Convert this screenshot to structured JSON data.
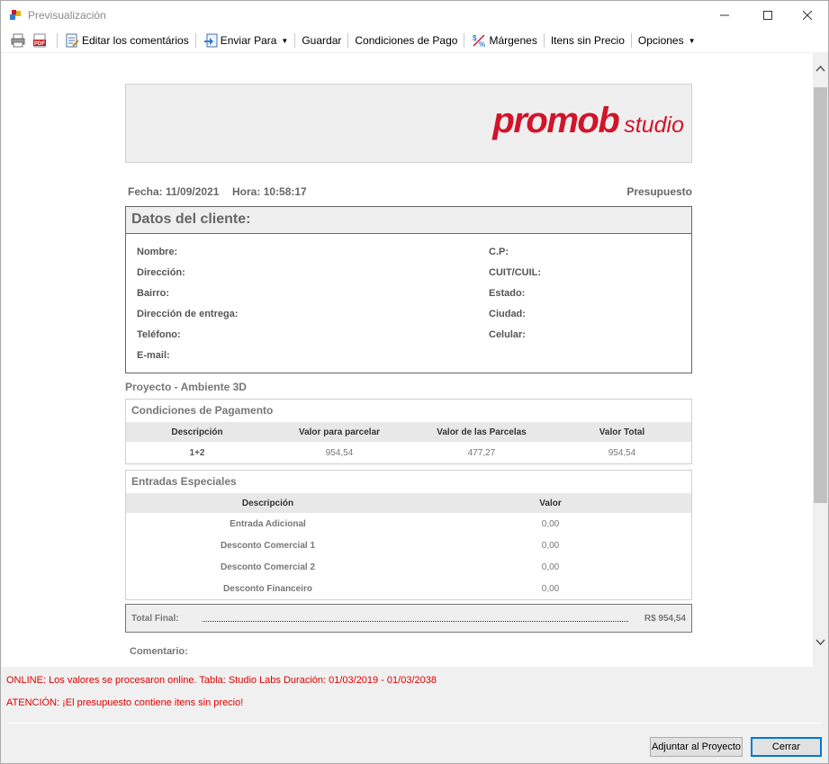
{
  "window": {
    "title": "Previsualización"
  },
  "toolbar": {
    "items": [
      {
        "icon": "print-icon"
      },
      {
        "icon": "pdf-icon",
        "label": "PDF"
      },
      {
        "icon": "edit-comments-icon",
        "label": "Editar los comentários"
      },
      {
        "icon": "send-icon",
        "label": "Enviar Para"
      },
      {
        "label": "Guardar"
      },
      {
        "label": "Condiciones de Pago"
      },
      {
        "icon": "margins-icon",
        "label": "Márgenes"
      },
      {
        "label": "Itens sin Precio"
      },
      {
        "label": "Opciones"
      }
    ]
  },
  "report": {
    "logo": {
      "main": "promob",
      "sub": "studio"
    },
    "fecha_label": "Fecha:",
    "fecha": "11/09/2021",
    "hora_label": "Hora:",
    "hora": "10:58:17",
    "doc_type": "Presupuesto",
    "client": {
      "title": "Datos del cliente:",
      "left_fields": [
        "Nombre:",
        "Dirección:",
        "Bairro:",
        "Dirección de entrega:",
        "Teléfono:",
        "E-mail:"
      ],
      "right_fields": [
        "C.P:",
        "CUIT/CUIL:",
        "Estado:",
        "Ciudad:",
        "Celular:"
      ]
    },
    "project_title": "Proyecto - Ambiente 3D",
    "payment": {
      "title": "Condiciones de Pagamento",
      "headers": [
        "Descripción",
        "Valor para parcelar",
        "Valor de las Parcelas",
        "Valor Total"
      ],
      "rows": [
        [
          "1+2",
          "954,54",
          "477,27",
          "954,54"
        ]
      ]
    },
    "special": {
      "title": "Entradas Especiales",
      "headers": [
        "Descripción",
        "Valor"
      ],
      "rows": [
        [
          "Entrada Adicional",
          "0,00"
        ],
        [
          "Desconto Comercial 1",
          "0,00"
        ],
        [
          "Desconto Comercial 2",
          "0,00"
        ],
        [
          "Desconto Financeiro",
          "0,00"
        ]
      ]
    },
    "total": {
      "label": "Total Final:",
      "value": "R$ 954,54"
    },
    "comment_label": "Comentario:"
  },
  "status": {
    "online": "ONLINE: Los valores se procesaron online. Tabla: Studio Labs Duración: 01/03/2019 - 01/03/2038",
    "warning": "ATENCIÓN: ¡El presupuesto contiene itens sin precio!"
  },
  "buttons": {
    "adjust": "Adjuntar al Proyecto",
    "close": "Cerrar"
  },
  "colors": {
    "brand": "#d0152b",
    "warning_text": "#e00000",
    "focus_border": "#0078d7"
  }
}
